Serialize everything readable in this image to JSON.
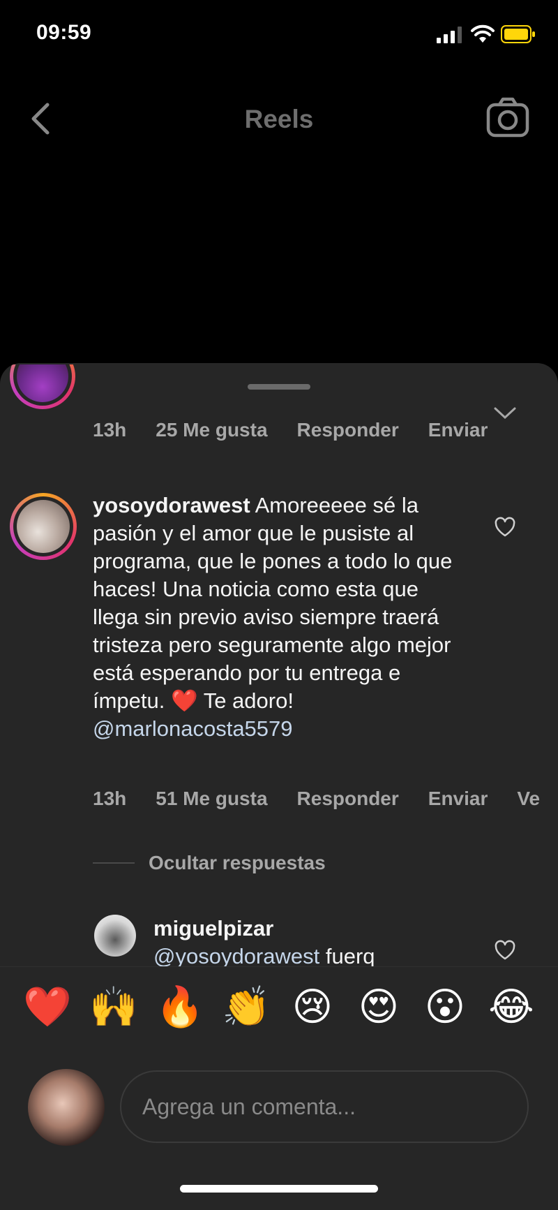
{
  "status_bar": {
    "time": "09:59"
  },
  "nav": {
    "title": "Reels"
  },
  "previous_comment": {
    "time": "13h",
    "likes": "25 Me gusta",
    "reply": "Responder",
    "send": "Enviar"
  },
  "comment": {
    "username": "yosoydorawest",
    "text_before_emoji": "Amoreeeee sé la pasión y el amor que le pusiste al programa, que le pones a todo lo que haces! Una noticia como esta que llega sin previo aviso siempre traerá tristeza pero seguramente algo mejor está esperando por tu entrega e ímpetu.",
    "emoji": "❤️",
    "text_after_emoji": "Te adoro!",
    "mention": "@marlonacosta5579",
    "time": "13h",
    "likes": "51 Me gusta",
    "reply": "Responder",
    "send": "Enviar",
    "overflow": "Ve"
  },
  "hide_replies": "Ocultar respuestas",
  "reply": {
    "username": "miguelpizar",
    "mention": "@yosoydorawest",
    "text": "fuerq"
  },
  "emoji_bar": [
    "❤️",
    "🙌",
    "🔥",
    "👏",
    "😢",
    "😍",
    "😮",
    "😂"
  ],
  "input": {
    "placeholder": "Agrega un comenta..."
  },
  "colors": {
    "sheet": "#262626",
    "muted": "#a8a8a8",
    "mention": "#c5d6ea",
    "battery": "#ffd60a"
  }
}
